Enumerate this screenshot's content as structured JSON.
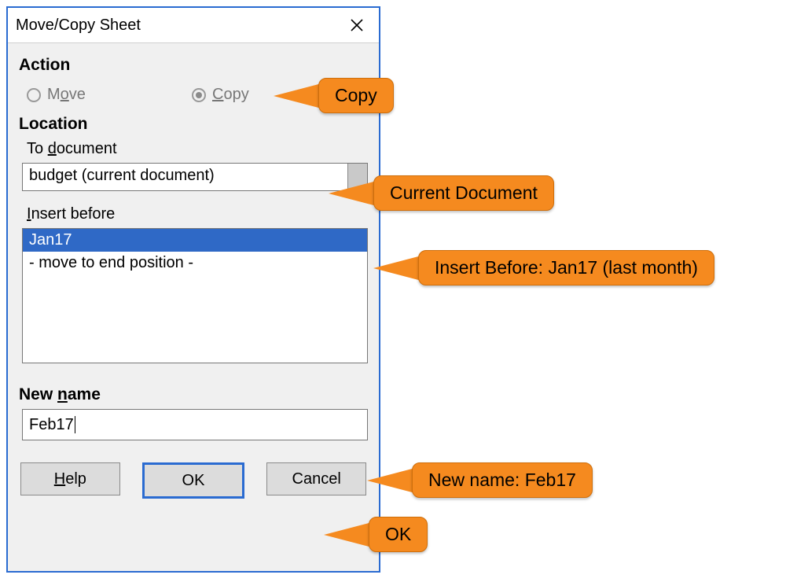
{
  "dialog": {
    "title": "Move/Copy Sheet",
    "sections": {
      "action": {
        "heading": "Action",
        "move_pre": "M",
        "move_ul": "o",
        "move_post": "ve",
        "copy_pre": "",
        "copy_ul": "C",
        "copy_post": "opy",
        "selected": "copy"
      },
      "location": {
        "heading": "Location",
        "to_doc_label_pre": "To ",
        "to_doc_label_ul": "d",
        "to_doc_label_post": "ocument",
        "to_doc_value": "budget (current document)",
        "insert_before_label_pre": "",
        "insert_before_label_ul": "I",
        "insert_before_label_post": "nsert before",
        "items": [
          {
            "label": "Jan17",
            "selected": true
          },
          {
            "label": "- move to end position -",
            "selected": false
          }
        ]
      },
      "newname": {
        "heading_pre": "New ",
        "heading_ul": "n",
        "heading_post": "ame",
        "value": "Feb17"
      }
    },
    "buttons": {
      "help_pre": "",
      "help_ul": "H",
      "help_post": "elp",
      "ok": "OK",
      "cancel": "Cancel"
    }
  },
  "callouts": {
    "copy": "Copy",
    "current_doc": "Current Document",
    "insert_before": "Insert Before: Jan17 (last month)",
    "new_name": "New name: Feb17",
    "ok": "OK"
  }
}
